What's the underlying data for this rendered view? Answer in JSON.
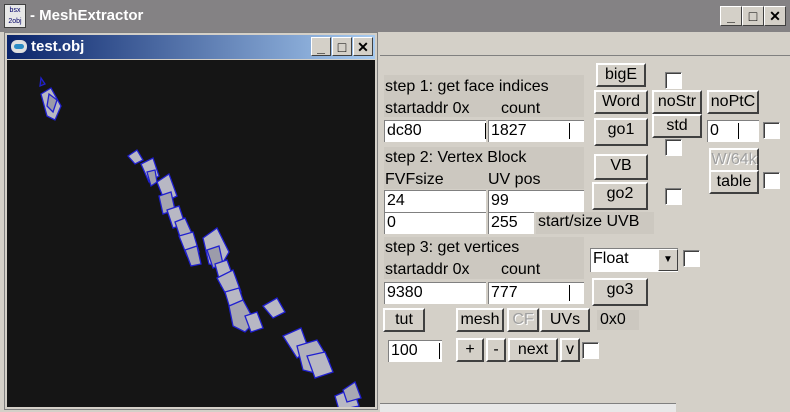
{
  "app": {
    "title": "- MeshExtractor",
    "icon_text": "bsx 2obj"
  },
  "child": {
    "title": "test.obj"
  },
  "window_controls": {
    "minimize": "_",
    "maximize": "□",
    "close": "✕"
  },
  "step1": {
    "title": "step 1: get face indices",
    "addr_label": "startaddr 0x",
    "count_label": "count",
    "addr_value": "dc80",
    "count_value": "1827"
  },
  "step2": {
    "title": "step 2: Vertex Block",
    "fvf_label": "FVFsize",
    "uvpos_label": "UV pos",
    "fvf_value": "24",
    "uvpos_value": "99",
    "start_value": "0",
    "size_value": "255",
    "startsize_label": "start/size UVB"
  },
  "step3": {
    "title": "step 3: get vertices",
    "addr_label": "startaddr 0x",
    "count_label": "count",
    "addr_value": "9380",
    "count_value": "777"
  },
  "buttons": {
    "bigE": "bigE",
    "word": "Word",
    "nostr": "noStr",
    "noptc": "noPtC",
    "go1": "go1",
    "std": "std",
    "vb": "VB",
    "w64k": "W/64k",
    "table": "table",
    "go2": "go2",
    "go3": "go3",
    "tut": "tut",
    "mesh": "mesh",
    "cf": "CF",
    "uvs": "UVs",
    "plus": "+",
    "minus": "-",
    "next": "next",
    "v": "v"
  },
  "fields": {
    "noptc_value": "0",
    "float_select": "Float",
    "hex_readout": "0x0",
    "step_value": "100"
  }
}
